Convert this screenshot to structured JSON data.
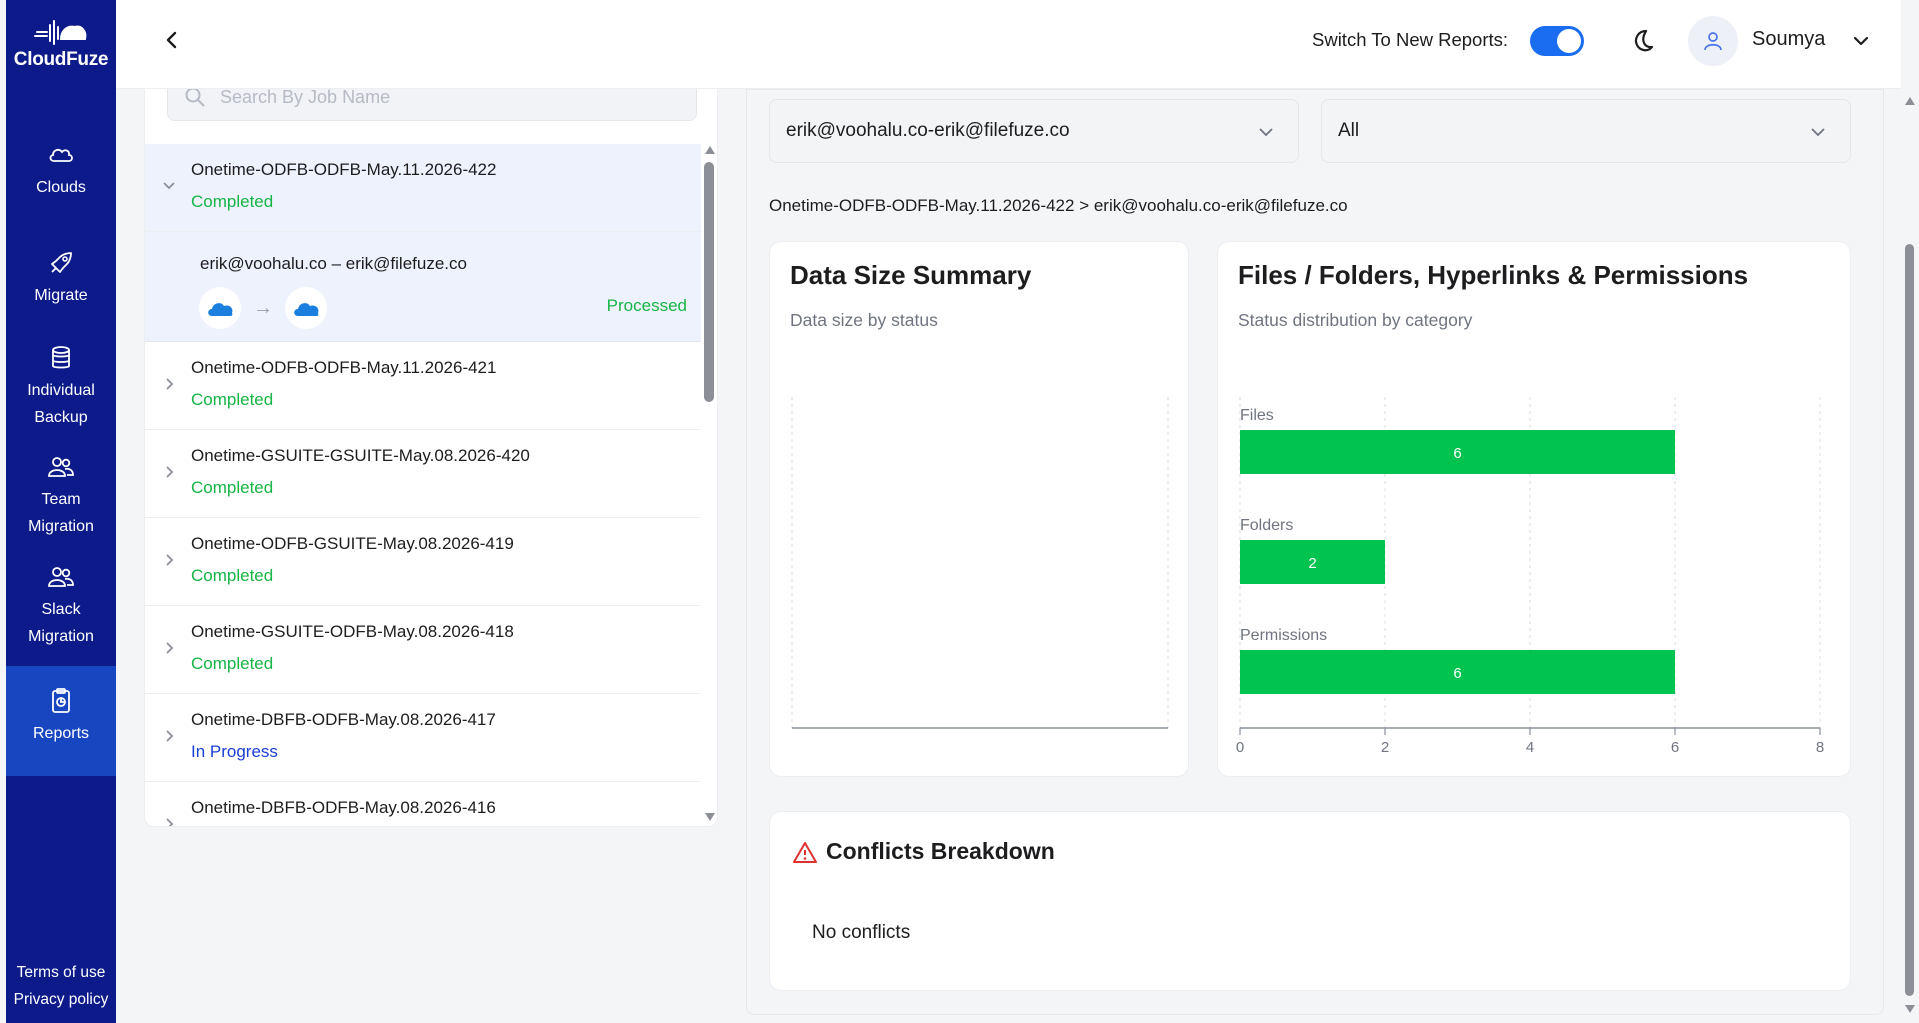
{
  "brand": {
    "name": "CloudFuze"
  },
  "sidebar": {
    "items": [
      {
        "label": "Clouds",
        "icon": "cloud-icon"
      },
      {
        "label": "Migrate",
        "icon": "rocket-icon"
      },
      {
        "label": "Individual Backup",
        "icon": "database-icon"
      },
      {
        "label": "Team Migration",
        "icon": "team-icon"
      },
      {
        "label": "Slack Migration",
        "icon": "team-icon"
      },
      {
        "label": "Reports",
        "icon": "report-icon",
        "active": true
      }
    ],
    "footer": {
      "terms": "Terms of use",
      "privacy": "Privacy policy"
    }
  },
  "header": {
    "switch_label": "Switch To New Reports:",
    "switch_on": true,
    "username": "Soumya"
  },
  "search": {
    "placeholder": "Search By Job Name"
  },
  "jobs": [
    {
      "name": "Onetime-ODFB-ODFB-May.11.2026-422",
      "status": "Completed",
      "expanded": true,
      "detail": {
        "pair": "erik@voohalu.co  –  erik@filefuze.co",
        "status": "Processed"
      }
    },
    {
      "name": "Onetime-ODFB-ODFB-May.11.2026-421",
      "status": "Completed"
    },
    {
      "name": "Onetime-GSUITE-GSUITE-May.08.2026-420",
      "status": "Completed"
    },
    {
      "name": "Onetime-ODFB-GSUITE-May.08.2026-419",
      "status": "Completed"
    },
    {
      "name": "Onetime-GSUITE-ODFB-May.08.2026-418",
      "status": "Completed"
    },
    {
      "name": "Onetime-DBFB-ODFB-May.08.2026-417",
      "status": "In Progress"
    },
    {
      "name": "Onetime-DBFB-ODFB-May.08.2026-416",
      "status": ""
    }
  ],
  "filters": {
    "user_pair": "erik@voohalu.co-erik@filefuze.co",
    "category": "All"
  },
  "breadcrumb": "Onetime-ODFB-ODFB-May.11.2026-422 > erik@voohalu.co-erik@filefuze.co",
  "data_size_card": {
    "title": "Data Size Summary",
    "subtitle": "Data size by status"
  },
  "files_card": {
    "title": "Files / Folders, Hyperlinks & Permissions",
    "subtitle": "Status distribution by category"
  },
  "chart_data": {
    "type": "bar",
    "orientation": "horizontal",
    "categories": [
      "Files",
      "Folders",
      "Permissions"
    ],
    "values": [
      6,
      2,
      6
    ],
    "xlim": [
      0,
      8
    ],
    "xticks": [
      0,
      2,
      4,
      6,
      8
    ],
    "grid": true,
    "bar_color": "#00c44f"
  },
  "conflicts": {
    "title": "Conflicts Breakdown",
    "message": "No conflicts"
  }
}
